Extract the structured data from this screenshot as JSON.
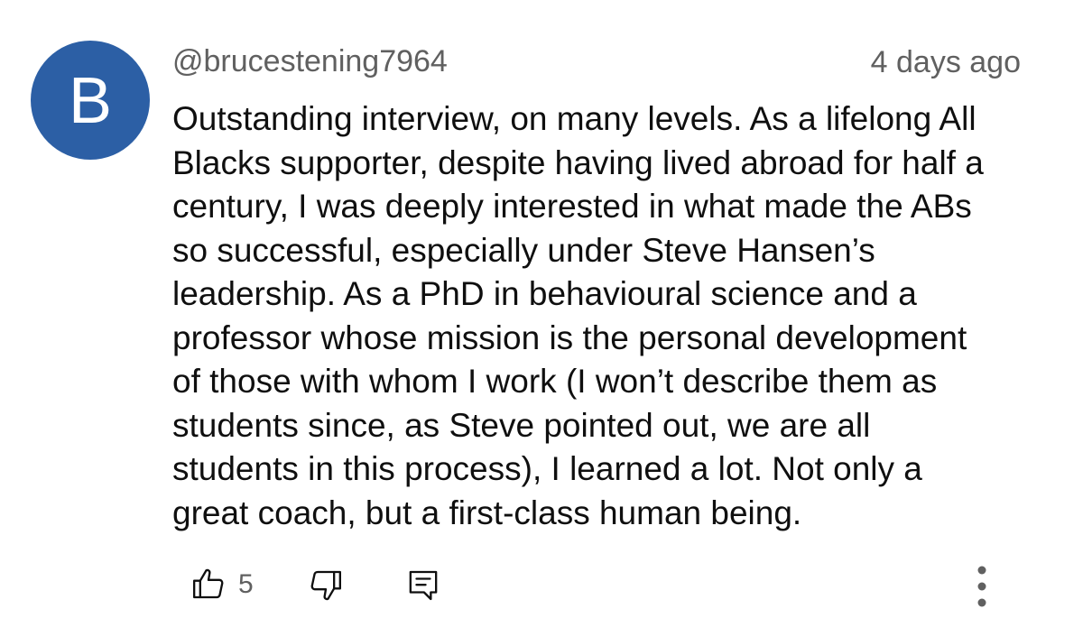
{
  "comment": {
    "avatar_letter": "B",
    "avatar_color": "#2c5fa5",
    "username": "@brucestening7964",
    "timestamp": "4 days ago",
    "text_lines": [
      "Outstanding interview, on many levels. As a lifelong All",
      "Blacks supporter, despite having lived abroad for half a",
      "century, I was deeply interested in what made the ABs",
      "so successful, especially under Steve Hansen’s",
      "leadership. As a PhD in behavioural science and a",
      "professor whose mission is the personal development",
      "of those with whom I work (I won’t describe them as",
      "students since, as Steve pointed out, we are all",
      "students in this process), I learned a lot. Not only a",
      "great coach, but a first-class human being."
    ],
    "like_count": "5"
  },
  "icons": {
    "like": "thumbs-up-icon",
    "dislike": "thumbs-down-icon",
    "reply": "reply-icon",
    "more": "more-vert-icon"
  }
}
